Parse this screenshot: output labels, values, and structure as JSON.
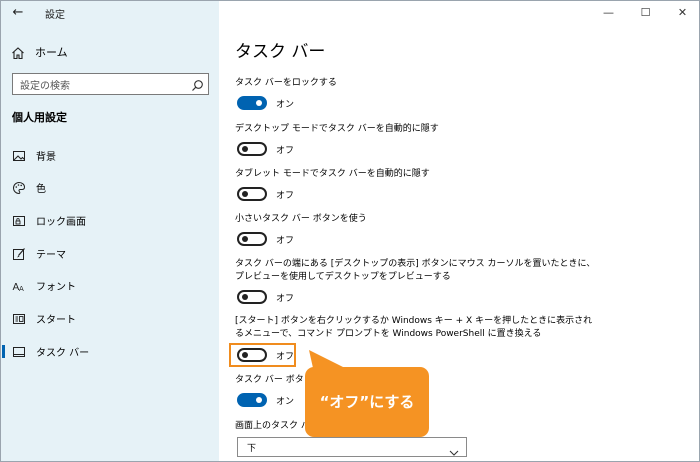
{
  "window": {
    "title": "設定",
    "controls": {
      "minimize": "—",
      "maximize": "☐",
      "close": "✕"
    }
  },
  "sidebar": {
    "home_label": "ホーム",
    "search_placeholder": "設定の検索",
    "section_title": "個人用設定",
    "items": [
      {
        "label": "背景",
        "icon": "picture-icon"
      },
      {
        "label": "色",
        "icon": "palette-icon"
      },
      {
        "label": "ロック画面",
        "icon": "lock-screen-icon"
      },
      {
        "label": "テーマ",
        "icon": "theme-brush-icon"
      },
      {
        "label": "フォント",
        "icon": "font-icon"
      },
      {
        "label": "スタート",
        "icon": "start-icon"
      },
      {
        "label": "タスク バー",
        "icon": "taskbar-icon",
        "active": true
      }
    ]
  },
  "main": {
    "page_title": "タスク バー",
    "settings": [
      {
        "label": "タスク バーをロックする",
        "state": "オン",
        "on": true
      },
      {
        "label": "デスクトップ モードでタスク バーを自動的に隠す",
        "state": "オフ",
        "on": false
      },
      {
        "label": "タブレット モードでタスク バーを自動的に隠す",
        "state": "オフ",
        "on": false
      },
      {
        "label": "小さいタスク バー ボタンを使う",
        "state": "オフ",
        "on": false
      },
      {
        "label_line1": "タスク バーの端にある [デスクトップの表示] ボタンにマウス カーソルを置いたときに、",
        "label_line2": "プレビューを使用してデスクトップをプレビューする",
        "state": "オフ",
        "on": false
      },
      {
        "label_line1": "[スタート] ボタンを右クリックするか Windows キー + X キーを押したときに表示され",
        "label_line2": "るメニューで、コマンド プロンプトを Windows PowerShell に置き換える",
        "state": "オフ",
        "on": false
      },
      {
        "label": "タスク バー ボタン",
        "state": "オン",
        "on": true
      },
      {
        "label": "画面上のタスク バ"
      }
    ],
    "dropdown_value": "下"
  },
  "callout": {
    "text": "“オフ”にする",
    "color": "#f59323"
  },
  "colors": {
    "accent": "#0063b1",
    "highlight": "#f08c1e",
    "sidebar_bg": "#e6f2f7"
  }
}
